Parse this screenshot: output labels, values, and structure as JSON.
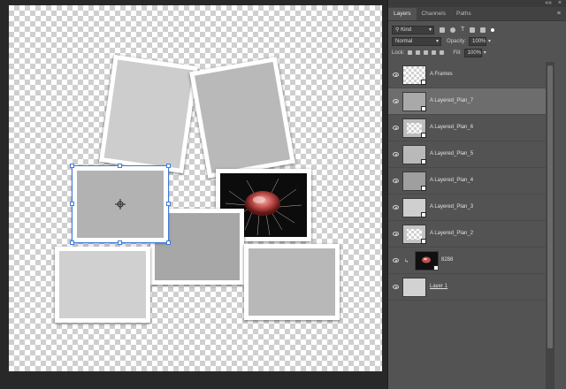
{
  "panel": {
    "window_controls": [
      "««",
      "×"
    ],
    "tabs": [
      {
        "label": "Layers",
        "active": true
      },
      {
        "label": "Channels",
        "active": false
      },
      {
        "label": "Paths",
        "active": false
      }
    ],
    "filter_label": "Kind",
    "blend_mode": "Normal",
    "opacity_label": "Opacity:",
    "opacity_value": "100%",
    "lock_label": "Lock:",
    "fill_label": "Fill:",
    "fill_value": "100%"
  },
  "layers": [
    {
      "name": "A Frames",
      "thumb": "checker",
      "selected": false,
      "clipped": false
    },
    {
      "name": "A Layered_Plan_7",
      "thumb": "gray",
      "selected": true,
      "clipped": false
    },
    {
      "name": "A Layered_Plan_6",
      "thumb": "gray",
      "selected": false,
      "clipped": false
    },
    {
      "name": "A Layered_Plan_5",
      "thumb": "gray",
      "selected": false,
      "clipped": false
    },
    {
      "name": "A Layered_Plan_4",
      "thumb": "gray",
      "selected": false,
      "clipped": false
    },
    {
      "name": "A Layered_Plan_3",
      "thumb": "gray",
      "selected": false,
      "clipped": false
    },
    {
      "name": "A Layered_Plan_2",
      "thumb": "gray",
      "selected": false,
      "clipped": false
    },
    {
      "name": "8288",
      "thumb": "photo",
      "selected": false,
      "clipped": true
    },
    {
      "name": "Layer 1",
      "thumb": "gray",
      "selected": false,
      "clipped": false
    }
  ],
  "colors": {
    "frame_fill_light": "#cdcdcd",
    "frame_fill_mid": "#b9b9b9",
    "frame_fill_dark": "#a7a7a7",
    "selection": "#3e7bd6",
    "panel_bg": "#535353"
  }
}
